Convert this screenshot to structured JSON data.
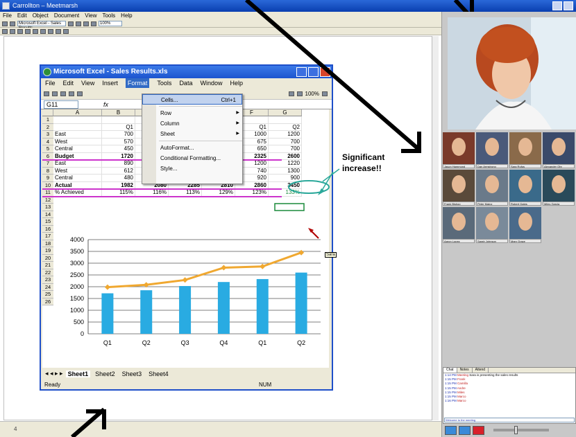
{
  "window": {
    "title": "Carrollton – Meetmarsh",
    "menus": [
      "File",
      "Edit",
      "Object",
      "Document",
      "View",
      "Tools",
      "Help"
    ]
  },
  "toolbar": {
    "combo_text": "Microsoft Excel - Sales Results",
    "zoom_text": "100%"
  },
  "statusbar": {
    "text": "4"
  },
  "excel": {
    "title": "Microsoft Excel - Sales Results.xls",
    "menus": [
      "File",
      "Edit",
      "View",
      "Insert",
      "Format",
      "Tools",
      "Data",
      "Window",
      "Help"
    ],
    "active_menu_index": 4,
    "zoom": "100%",
    "namebox": "G11",
    "fx": "fx",
    "columns": [
      "A",
      "B",
      "C",
      "D",
      "E",
      "F",
      "G"
    ],
    "rows": [
      {
        "n": "1",
        "a": "",
        "b": "",
        "c": "",
        "d": "",
        "e": "",
        "f": "",
        "g": ""
      },
      {
        "n": "2",
        "a": "",
        "b": "Q1",
        "c": "",
        "d": "",
        "e": "",
        "f": "Q1",
        "g": "Q2"
      },
      {
        "n": "3",
        "a": "East",
        "b": "700",
        "c": "",
        "d": "",
        "e": "",
        "f": "1000",
        "g": "1200"
      },
      {
        "n": "4",
        "a": "West",
        "b": "570",
        "c": "",
        "d": "",
        "e": "",
        "f": "675",
        "g": "700"
      },
      {
        "n": "5",
        "a": "Central",
        "b": "450",
        "c": "",
        "d": "",
        "e": "",
        "f": "650",
        "g": "700"
      },
      {
        "n": "6",
        "a": "Budget",
        "b": "1720",
        "c": "",
        "d": "",
        "e": "",
        "f": "2325",
        "g": "2600"
      },
      {
        "n": "7",
        "a": "East",
        "b": "890",
        "c": "920",
        "d": "1115",
        "e": "1260",
        "f": "1200",
        "g": "1220"
      },
      {
        "n": "8",
        "a": "West",
        "b": "612",
        "c": "650",
        "d": "690",
        "e": "720",
        "f": "740",
        "g": "1300"
      },
      {
        "n": "9",
        "a": "Central",
        "b": "480",
        "c": "510",
        "d": "480",
        "e": "840",
        "f": "920",
        "g": "900"
      },
      {
        "n": "10",
        "a": "Actual",
        "b": "1982",
        "c": "2080",
        "d": "2285",
        "e": "2810",
        "f": "2860",
        "g": "3450"
      },
      {
        "n": "11",
        "a": "% Achieved",
        "b": "115%",
        "c": "116%",
        "d": "113%",
        "e": "129%",
        "f": "123%",
        "g": "133%"
      }
    ],
    "empty_rows": [
      "12",
      "13",
      "14",
      "15",
      "16",
      "17",
      "18",
      "19",
      "20",
      "21",
      "22",
      "23",
      "24",
      "25",
      "26"
    ],
    "format_menu": [
      {
        "label": "Cells...",
        "shortcut": "Ctrl+1",
        "submenu": false
      },
      {
        "label": "Row",
        "shortcut": "",
        "submenu": true
      },
      {
        "label": "Column",
        "shortcut": "",
        "submenu": true
      },
      {
        "label": "Sheet",
        "shortcut": "",
        "submenu": true
      },
      {
        "label": "AutoFormat...",
        "shortcut": "",
        "submenu": false
      },
      {
        "label": "Conditional Formatting...",
        "shortcut": "",
        "submenu": false
      },
      {
        "label": "Style...",
        "shortcut": "",
        "submenu": false
      }
    ],
    "sheet_tabs": [
      "Sheet1",
      "Sheet2",
      "Sheet3",
      "Sheet4"
    ],
    "active_sheet": 0,
    "status_left": "Ready",
    "status_right": "NUM"
  },
  "chart_data": {
    "type": "bar",
    "categories": [
      "Q1",
      "Q2",
      "Q3",
      "Q4",
      "Q1",
      "Q2"
    ],
    "series": [
      {
        "type": "bar",
        "values": [
          1720,
          1850,
          2030,
          2200,
          2325,
          2600
        ],
        "color": "#29abe2"
      },
      {
        "type": "line",
        "values": [
          1982,
          2080,
          2285,
          2810,
          2860,
          3450
        ],
        "color": "#f0a830"
      }
    ],
    "ylim": [
      0,
      4000
    ],
    "yticks": [
      "0",
      "500",
      "1000",
      "1500",
      "2000",
      "2500",
      "3000",
      "3500",
      "4000"
    ],
    "grid": true
  },
  "annotation": {
    "line1": "Significant",
    "line2": "increase!!",
    "tooltip": "Sara"
  },
  "participants": [
    {
      "name": "Jason Hammond"
    },
    {
      "name": "Dan Armstrong"
    },
    {
      "name": "Sara Rufus"
    },
    {
      "name": "Alexander Ohr"
    },
    {
      "name": "Frank Bishop"
    },
    {
      "name": "Peter Mainz"
    },
    {
      "name": "Robert Gates"
    },
    {
      "name": "Miles Garcia"
    },
    {
      "name": "Aaron Lopez"
    },
    {
      "name": "Sarah Johnson"
    },
    {
      "name": "Mary Grace"
    }
  ],
  "chat": {
    "tabs": [
      "Chat",
      "Notes",
      "Attend"
    ],
    "messages": [
      {
        "time": "1:14 PM",
        "name": "Meeting",
        "text": "Sara is presenting the sales results"
      },
      {
        "time": "1:15 PM",
        "name": "Frank",
        "text": ""
      },
      {
        "time": "1:15 PM",
        "name": "Camilla",
        "text": ""
      },
      {
        "time": "1:15 PM",
        "name": "Andre",
        "text": ""
      },
      {
        "time": "1:15 PM",
        "name": "Miles",
        "text": ""
      },
      {
        "time": "1:15 PM",
        "name": "Marco",
        "text": ""
      },
      {
        "time": "1:16 PM",
        "name": "Marco",
        "text": ""
      }
    ],
    "input_placeholder": "Welcome to the meeting"
  },
  "colors": {
    "titlebar": "#0a3fb0",
    "highlight_magenta": "#cc33cc",
    "ellipse_teal": "#2aa89a",
    "arrow": "#000000"
  }
}
